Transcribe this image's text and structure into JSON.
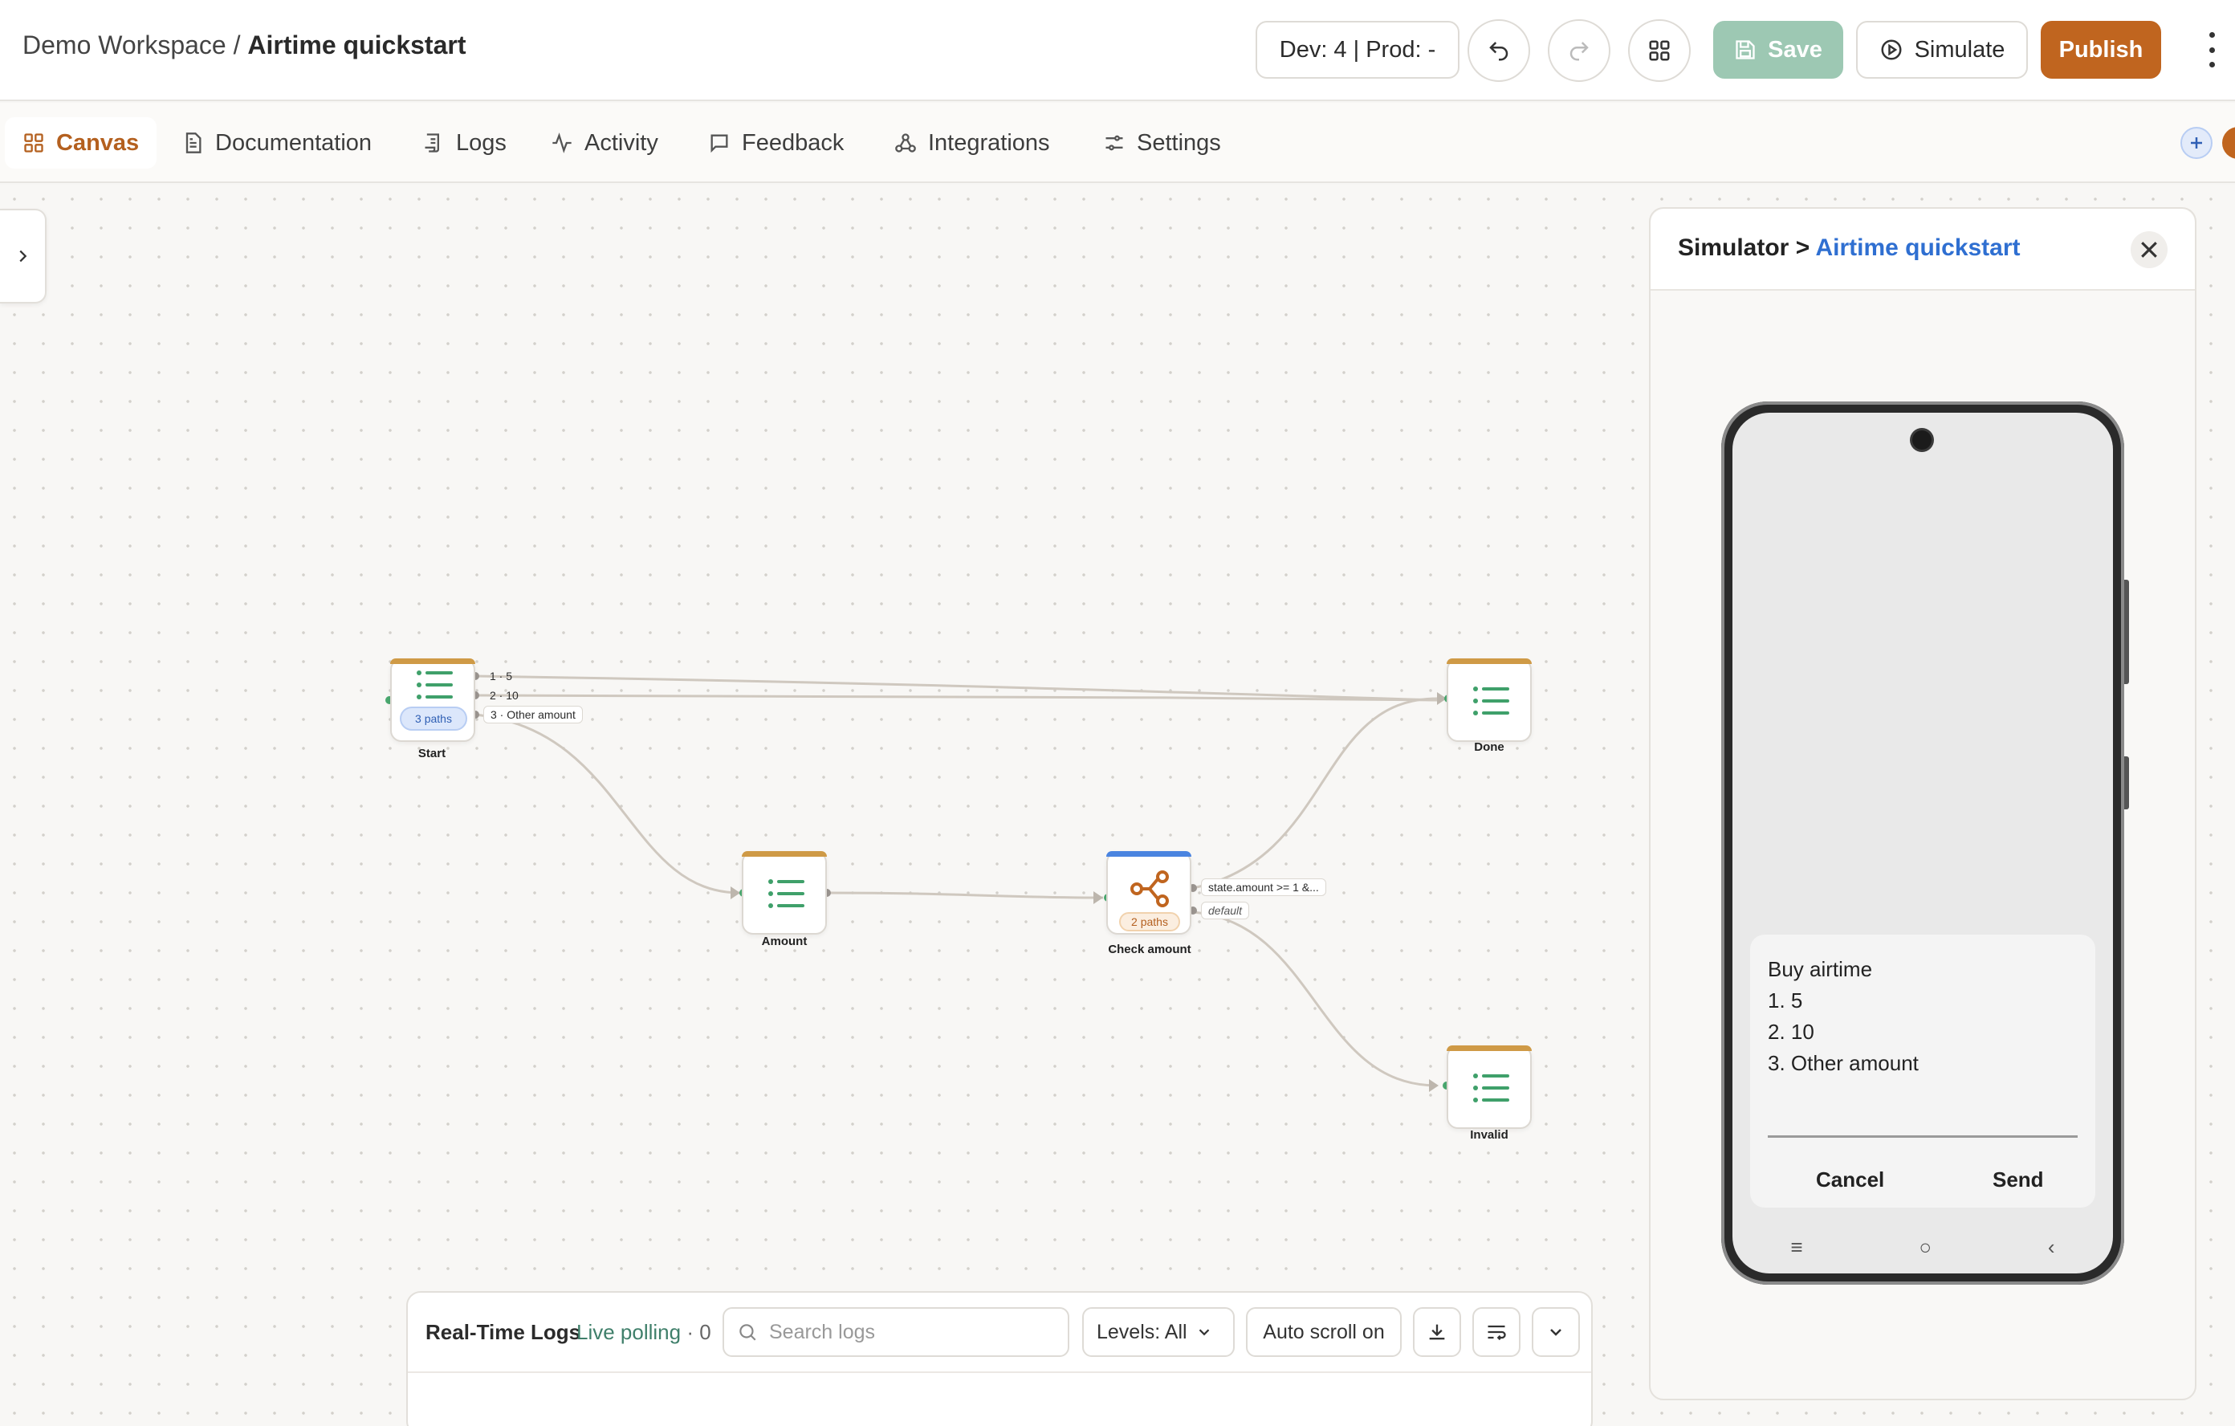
{
  "header": {
    "workspace": "Demo Workspace",
    "separator": "/",
    "project": "Airtime quickstart",
    "version": "Dev: 4 | Prod: -",
    "save_label": "Save",
    "simulate_label": "Simulate",
    "publish_label": "Publish",
    "colors": {
      "publish": "#c0651f",
      "save": "#9dc8b3"
    }
  },
  "tabs": [
    {
      "label": "Canvas",
      "icon": "grid-icon",
      "active": true
    },
    {
      "label": "Documentation",
      "icon": "document-icon"
    },
    {
      "label": "Logs",
      "icon": "scroll-icon"
    },
    {
      "label": "Activity",
      "icon": "activity-icon"
    },
    {
      "label": "Feedback",
      "icon": "message-icon"
    },
    {
      "label": "Integrations",
      "icon": "integrations-icon"
    },
    {
      "label": "Settings",
      "icon": "sliders-icon"
    }
  ],
  "canvas": {
    "nodes": {
      "start": {
        "label": "Start",
        "badge": "3 paths",
        "ports": [
          "1 · 5",
          "2 · 10",
          "3 · Other amount"
        ]
      },
      "amount": {
        "label": "Amount"
      },
      "check": {
        "label": "Check amount",
        "badge": "2 paths",
        "ports": [
          "state.amount >= 1 &...",
          "default"
        ]
      },
      "done": {
        "label": "Done"
      },
      "invalid": {
        "label": "Invalid"
      }
    }
  },
  "logs": {
    "title": "Real-Time Logs",
    "status": "Live polling",
    "count": "· 0",
    "search_placeholder": "Search logs",
    "levels_label": "Levels: All",
    "autoscroll_label": "Auto scroll on"
  },
  "simulator": {
    "title_prefix": "Simulator >",
    "title_flow": "Airtime quickstart",
    "message_lines": [
      "Buy airtime",
      "1. 5",
      "2. 10",
      "3. Other amount"
    ],
    "input_value": "",
    "cancel_label": "Cancel",
    "send_label": "Send",
    "nav_icons": [
      "≡",
      "○",
      "‹"
    ]
  }
}
